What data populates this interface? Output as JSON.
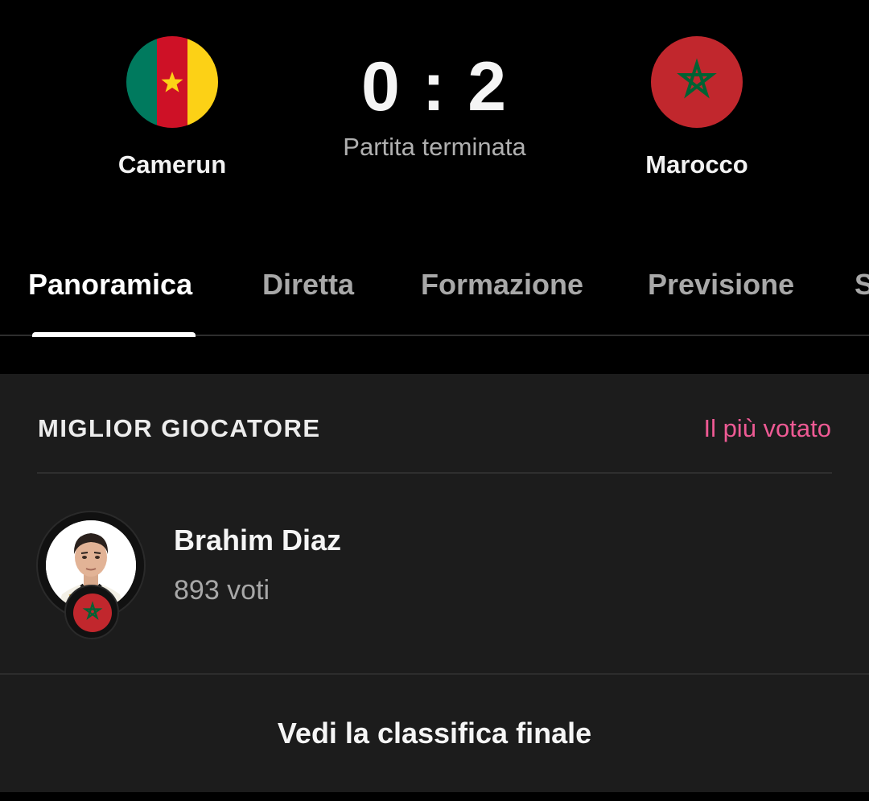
{
  "match": {
    "home": {
      "name": "Camerun",
      "flag_icon": "cameroon-flag-icon"
    },
    "away": {
      "name": "Marocco",
      "flag_icon": "morocco-flag-icon"
    },
    "score": "0 : 2",
    "status": "Partita terminata"
  },
  "tabs": [
    {
      "label": "Panoramica",
      "active": true
    },
    {
      "label": "Diretta",
      "active": false
    },
    {
      "label": "Formazione",
      "active": false
    },
    {
      "label": "Previsione",
      "active": false
    },
    {
      "label": "S",
      "active": false
    }
  ],
  "best_player": {
    "title": "MIGLIOR GIOCATORE",
    "link": "Il più votato",
    "player_name": "Brahim Diaz",
    "votes": "893 voti",
    "team_badge_icon": "morocco-flag-icon",
    "button": "Vedi la classifica finale"
  },
  "colors": {
    "background": "#000000",
    "card": "#1c1c1c",
    "accent_pink": "#ee5a94",
    "cameroon_green": "#007a5e",
    "cameroon_red": "#ce1126",
    "cameroon_yellow": "#fcd116",
    "morocco_red": "#c1272d",
    "morocco_green": "#006233"
  }
}
